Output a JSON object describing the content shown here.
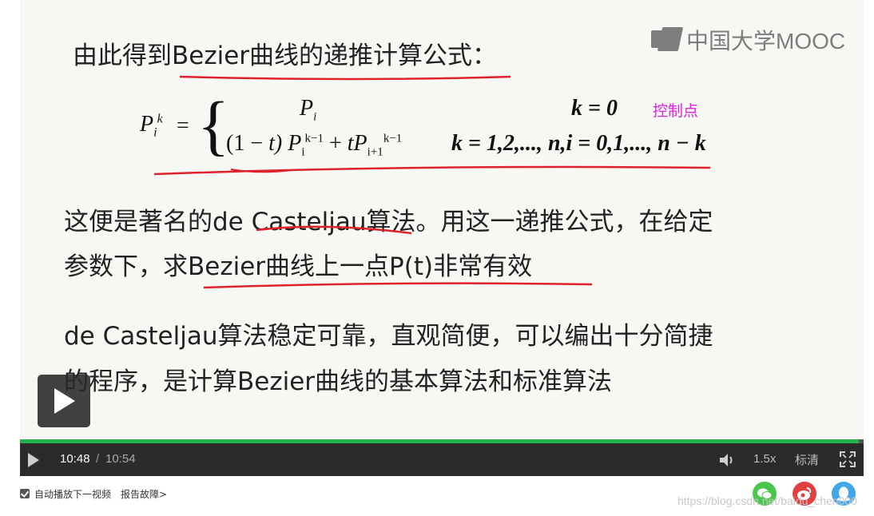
{
  "slide": {
    "logo_text": "中国大学MOOC",
    "title": "由此得到Bezier曲线的递推计算公式：",
    "formula": {
      "lhs": "P",
      "lhs_sub": "i",
      "lhs_sup": "k",
      "eq": "=",
      "brace": "{",
      "row1_expr": "P",
      "row1_sub": "i",
      "row1_cond": "k = 0",
      "row2_a": "(1 − ",
      "row2_t": "t",
      "row2_b": ") P",
      "row2_sub1": "i",
      "row2_sup1": "k−1",
      "row2_c": " + ",
      "row2_tp": "tP",
      "row2_sub2": "i+1",
      "row2_sup2": "k−1",
      "row2_cond": "k = 1,2,..., n,i = 0,1,..., n − k"
    },
    "annotation": "控制点",
    "para1_line1": "这便是著名的de Casteljau算法。用这一递推公式，在给定",
    "para1_line2": "参数下，求Bezier曲线上一点P(t)非常有效",
    "para2_line1": "de Casteljau算法稳定可靠，直观简便，可以编出十分简捷",
    "para2_line2": "的程序，是计算Bezier曲线的基本算法和标准算法"
  },
  "player": {
    "progress_percent": 99.4,
    "current_time": "10:48",
    "separator": "/",
    "total_time": "10:54",
    "speed": "1.5x",
    "quality": "标清",
    "accent_color": "#22b14c"
  },
  "below": {
    "autoplay_label": "自动播放下一视频",
    "report_label": "报告故障>",
    "watermark": "https://blog.csdn.net/baidu_chen000"
  }
}
